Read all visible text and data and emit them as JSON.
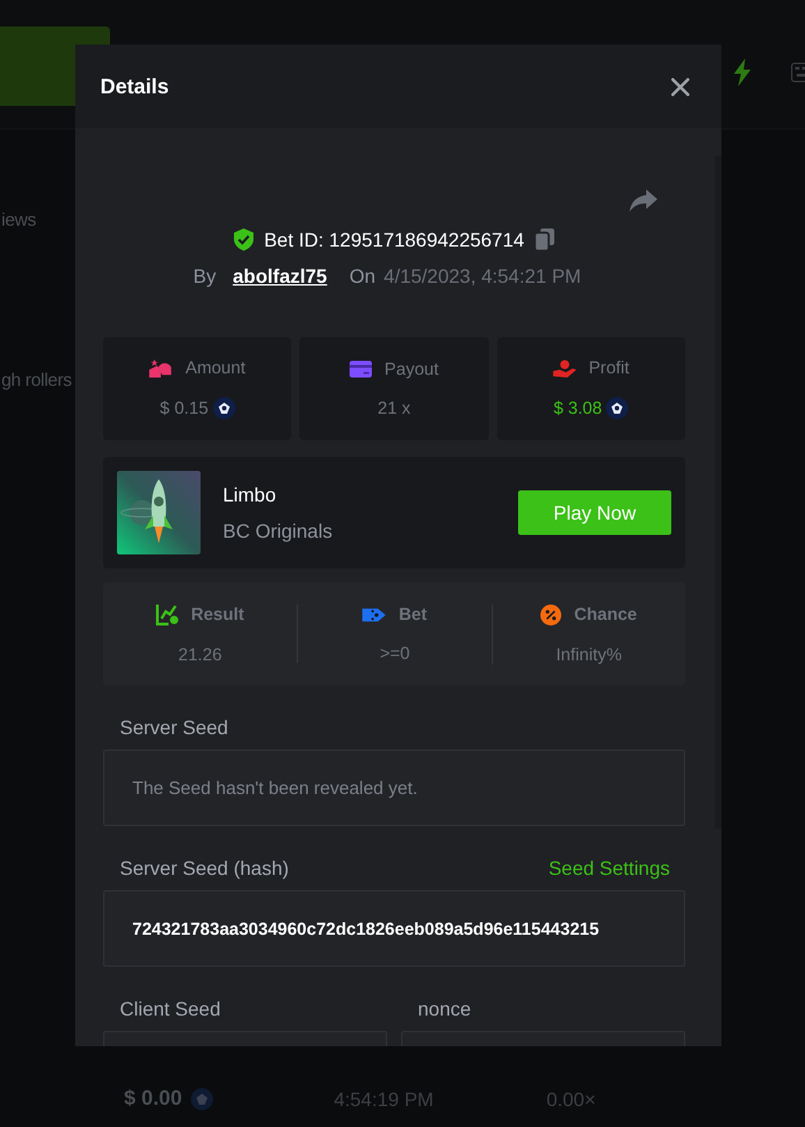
{
  "background": {
    "side_items": [
      "iews",
      "gh rollers"
    ],
    "bottom_row": {
      "amount": "$ 0.00",
      "time": "4:54:19 PM",
      "payout": "0.00×"
    }
  },
  "dialog": {
    "title": "Details",
    "bet_id": "Bet ID: 129517186942256714",
    "by_label": "By",
    "user": "abolfazl75",
    "on_label": "On",
    "date": "4/15/2023, 4:54:21 PM",
    "stats": [
      {
        "kind": "amount",
        "label": "Amount",
        "value": "$ 0.15",
        "coin": true,
        "highlight": false
      },
      {
        "kind": "payout",
        "label": "Payout",
        "value": "21 x",
        "coin": false,
        "highlight": false
      },
      {
        "kind": "profit",
        "label": "Profit",
        "value": "$ 3.08",
        "coin": true,
        "highlight": true
      }
    ],
    "game": {
      "name": "Limbo",
      "provider": "BC Originals",
      "button": "Play Now"
    },
    "outcome": [
      {
        "kind": "result",
        "label": "Result",
        "value": "21.26"
      },
      {
        "kind": "bet",
        "label": "Bet",
        "value": ">=0"
      },
      {
        "kind": "chance",
        "label": "Chance",
        "value": "Infinity%"
      }
    ],
    "server_seed": {
      "label": "Server Seed",
      "text": "The Seed hasn't been revealed yet."
    },
    "server_seed_hash": {
      "label": "Server Seed (hash)",
      "link": "Seed Settings",
      "value": "724321783aa3034960c72dc1826eeb089a5d96e115443215"
    },
    "client_seed": {
      "label": "Client Seed"
    },
    "nonce": {
      "label": "nonce"
    }
  }
}
